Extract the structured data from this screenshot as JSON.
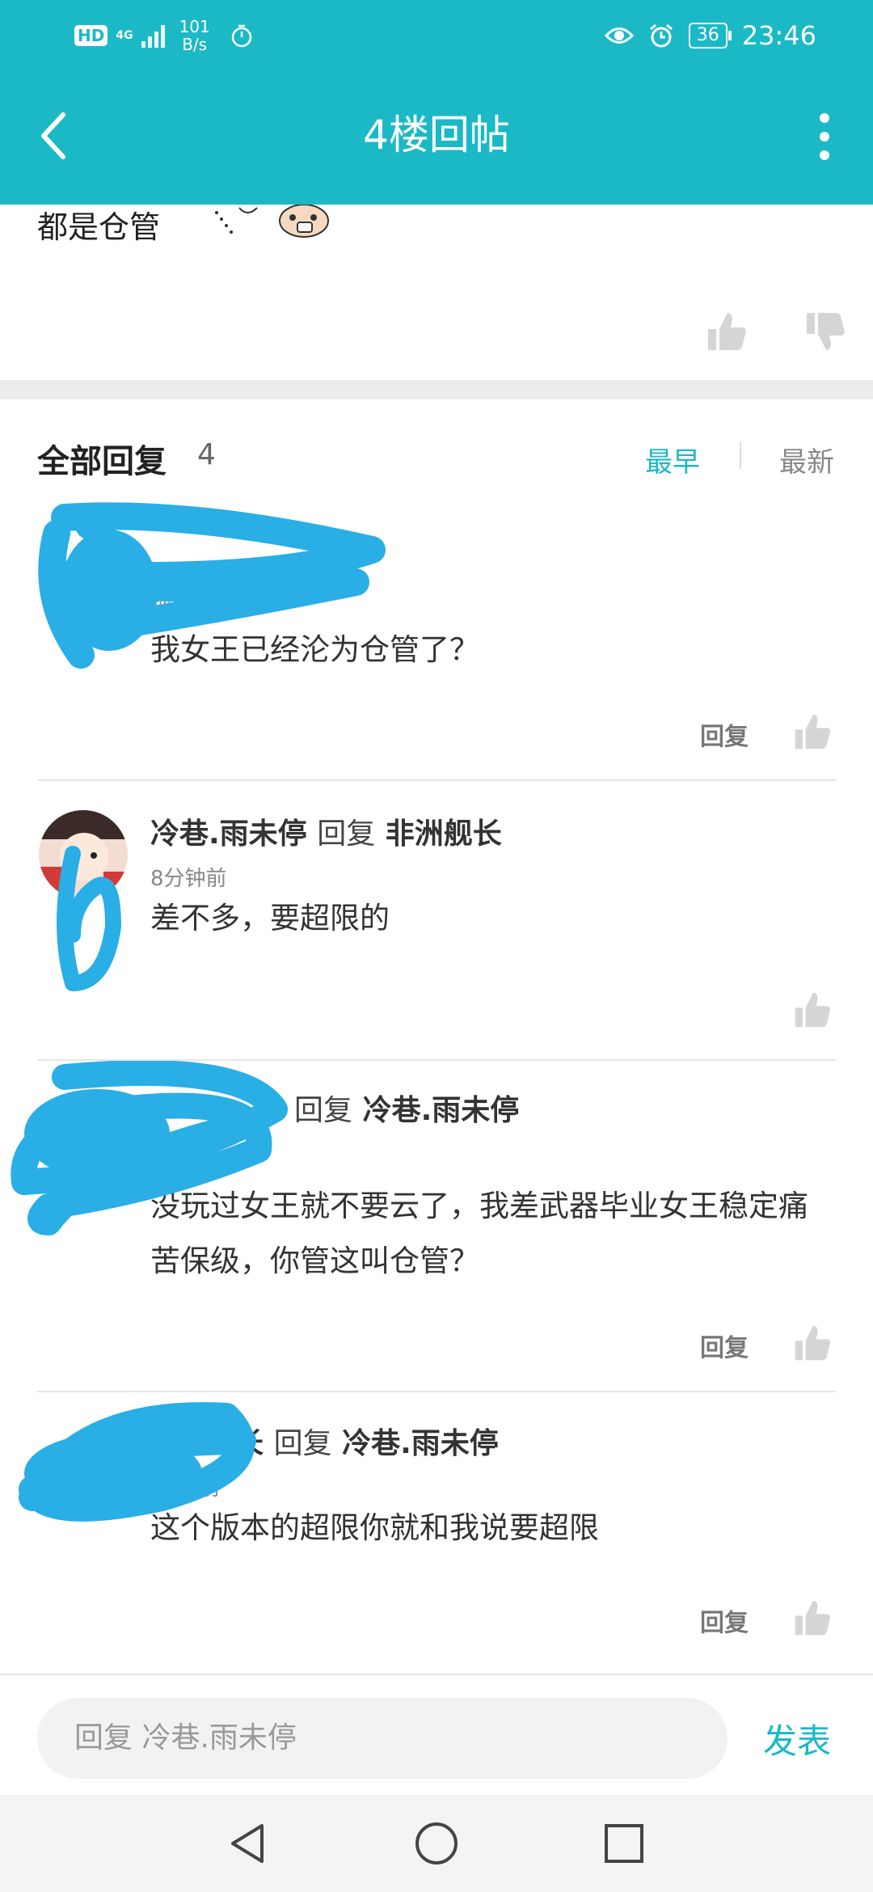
{
  "status_bar": {
    "hd": "HD",
    "network": "4G",
    "speed_value": "101",
    "speed_unit": "B/s",
    "battery": "36",
    "time": "23:46"
  },
  "header": {
    "title": "4楼回帖",
    "back_icon": "chevron-left-icon",
    "more_icon": "more-vertical-icon"
  },
  "post": {
    "text": "都是仓管"
  },
  "replies_header": {
    "title": "全部回复",
    "count": "4",
    "sort_earliest": "最早",
    "sort_latest": "最新"
  },
  "replies": [
    {
      "time": "钟前",
      "content": "我女王已经沦为仓管了？",
      "reply_label": "回复"
    },
    {
      "user": "冷巷.雨未停",
      "reply_word": "回复",
      "target": "非洲舰长",
      "time": "8分钟前",
      "content": "差不多，要超限的"
    },
    {
      "reply_word": "回复",
      "target": "冷巷.雨未停",
      "content": "没玩过女王就不要云了，我差武器毕业女王稳定痛苦保级，你管这叫仓管？",
      "reply_label": "回复"
    },
    {
      "user_partial": "长",
      "reply_word": "回复",
      "target": "冷巷.雨未停",
      "time": "秒前",
      "content": "这个版本的超限你就和我说要超限",
      "reply_label": "回复"
    }
  ],
  "input_bar": {
    "placeholder": "回复 冷巷.雨未停",
    "send": "发表"
  },
  "colors": {
    "accent": "#1bb9c6",
    "scribble": "#29aee6"
  }
}
